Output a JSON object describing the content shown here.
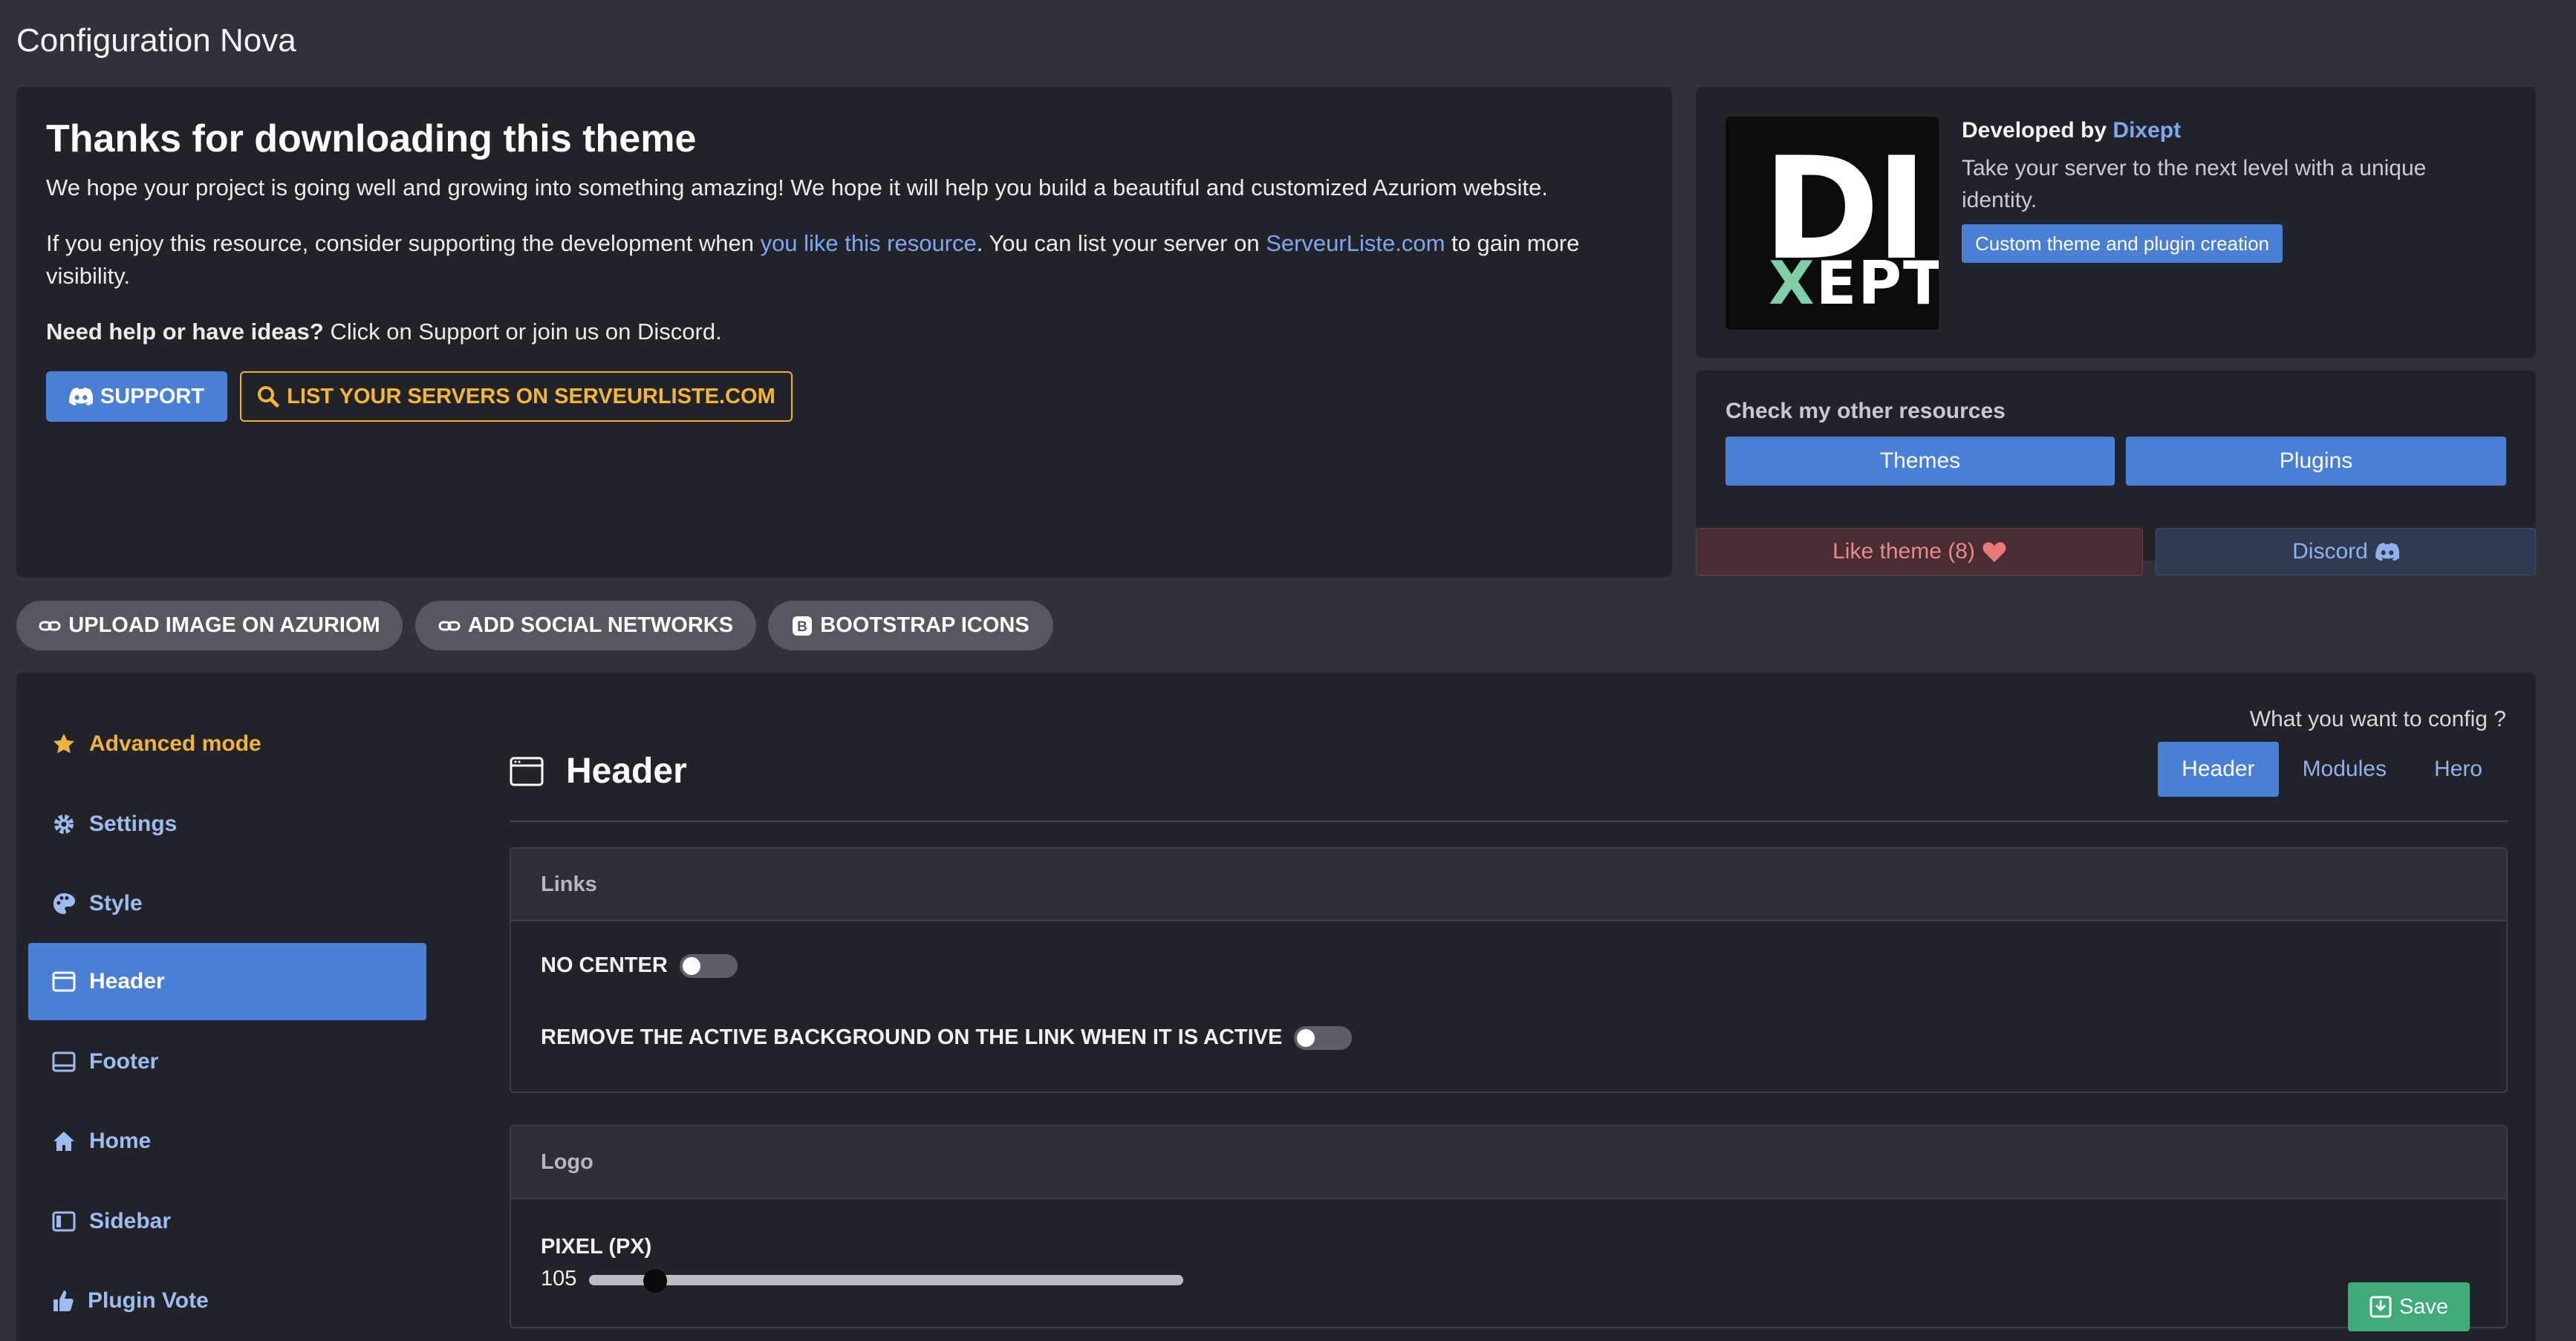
{
  "page": {
    "title": "Configuration Nova"
  },
  "intro": {
    "heading": "Thanks for downloading this theme",
    "line1": "We hope your project is going well and growing into something amazing! We hope it will help you build a beautiful and customized Azuriom website.",
    "line2_prefix": "If you enjoy this resource, consider supporting the development when ",
    "line2_link1": "you like this resource",
    "line2_mid": ". You can list your server on ",
    "line2_link2": "ServeurListe.com",
    "line2_suffix": " to gain more visibility.",
    "help_bold": "Need help or have ideas?",
    "help_rest": " Click on Support or join us on Discord.",
    "support_label": "SUPPORT",
    "list_label": "LIST YOUR SERVERS ON SERVEURLISTE.COM"
  },
  "developer": {
    "logo_top": "DI",
    "logo_bottom_x": "X",
    "logo_bottom_rest": "EPT",
    "by_prefix": "Developed by ",
    "by_name": "Dixept",
    "description": "Take your server to the next level with a unique identity.",
    "button": "Custom theme and plugin creation"
  },
  "resources": {
    "title": "Check my other resources",
    "themes": "Themes",
    "plugins": "Plugins"
  },
  "like": {
    "label": "Like theme (8)"
  },
  "discord": {
    "label": "Discord"
  },
  "quick_links": {
    "upload": "UPLOAD IMAGE ON AZURIOM",
    "social": "ADD SOCIAL NETWORKS",
    "bootstrap": "BOOTSTRAP ICONS"
  },
  "sidebar": {
    "items": [
      {
        "label": "Advanced mode",
        "icon": "star-icon"
      },
      {
        "label": "Settings",
        "icon": "gear-icon"
      },
      {
        "label": "Style",
        "icon": "palette-icon"
      },
      {
        "label": "Header",
        "icon": "window-icon"
      },
      {
        "label": "Footer",
        "icon": "footer-icon"
      },
      {
        "label": "Home",
        "icon": "house-icon"
      },
      {
        "label": "Sidebar",
        "icon": "sidebar-icon"
      },
      {
        "label": "Plugin Vote",
        "icon": "thumbs-up-icon"
      }
    ],
    "active": "Header"
  },
  "config": {
    "prompt": "What you want to config ?",
    "tabs": [
      "Header",
      "Modules",
      "Hero"
    ],
    "active_tab": "Header",
    "section_title": "Header"
  },
  "links_card": {
    "title": "Links",
    "opt1": "NO CENTER",
    "opt2": "REMOVE THE ACTIVE BACKGROUND ON THE LINK WHEN IT IS ACTIVE"
  },
  "logo_card": {
    "title": "Logo",
    "slider_label": "PIXEL (PX)",
    "slider_value": "105"
  },
  "save": {
    "label": "Save"
  },
  "colors": {
    "accent": "#4a7fd6",
    "warning": "#f0b429",
    "success": "#3faa7a",
    "background": "#2f3239",
    "panel": "#212328"
  }
}
